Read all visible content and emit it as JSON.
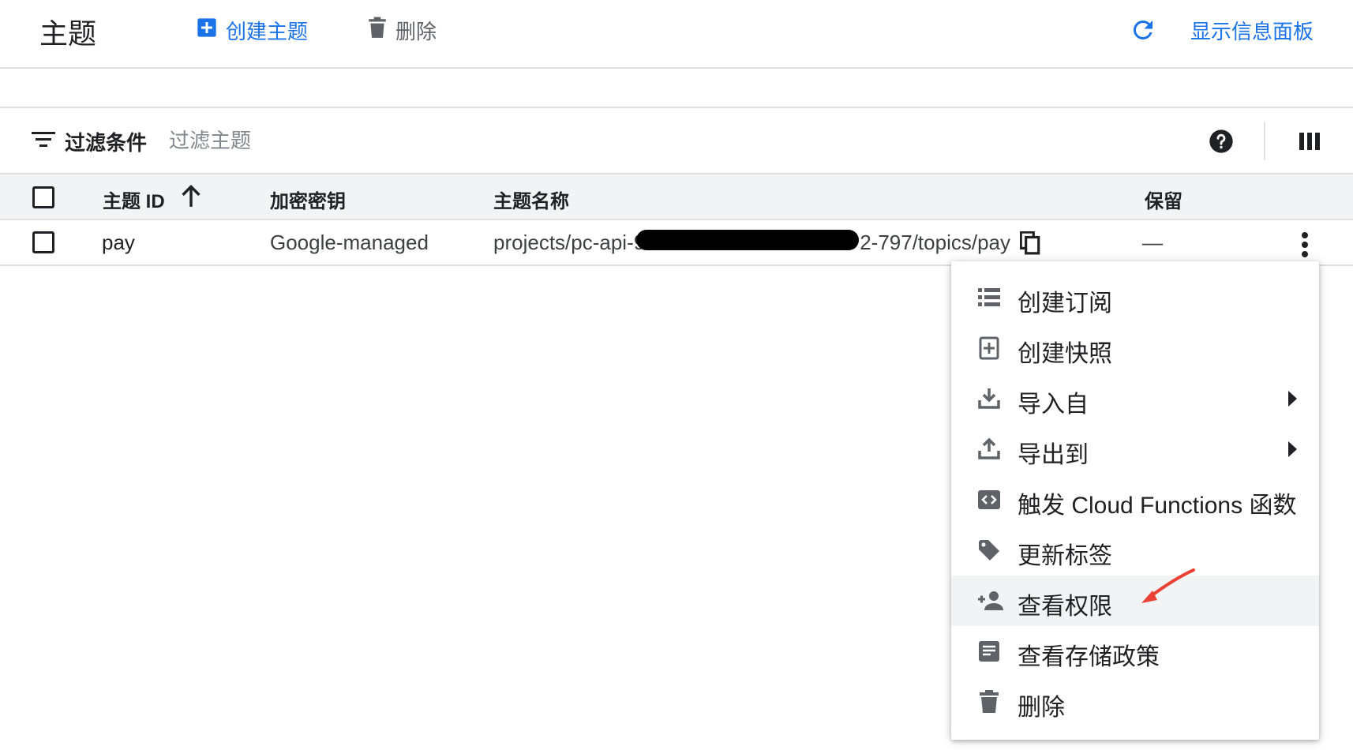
{
  "header": {
    "title": "主题",
    "create_label": "创建主题",
    "delete_label": "删除",
    "show_panel_label": "显示信息面板"
  },
  "filter": {
    "label": "过滤条件",
    "placeholder": "过滤主题"
  },
  "table": {
    "columns": [
      "主题 ID",
      "加密密钥",
      "主题名称",
      "保留"
    ],
    "rows": [
      {
        "id": "pay",
        "encryption": "Google-managed",
        "name_prefix": "projects/pc-api-9",
        "name_suffix": "2-797/topics/pay",
        "retention": "—"
      }
    ]
  },
  "menu": {
    "items": [
      {
        "label": "创建订阅",
        "icon": "list-icon"
      },
      {
        "label": "创建快照",
        "icon": "snapshot-add-icon"
      },
      {
        "label": "导入自",
        "icon": "download-icon",
        "submenu": true
      },
      {
        "label": "导出到",
        "icon": "upload-icon",
        "submenu": true
      },
      {
        "label": "触发 Cloud Functions 函数",
        "icon": "code-icon"
      },
      {
        "label": "更新标签",
        "icon": "label-icon"
      },
      {
        "label": "查看权限",
        "icon": "person-add-icon",
        "highlighted": true
      },
      {
        "label": "查看存储政策",
        "icon": "document-icon"
      },
      {
        "label": "删除",
        "icon": "trash-icon"
      }
    ]
  },
  "colors": {
    "accent": "#1a73e8",
    "annotation_arrow": "#ea4335",
    "highlight": "#f1f3f4"
  }
}
